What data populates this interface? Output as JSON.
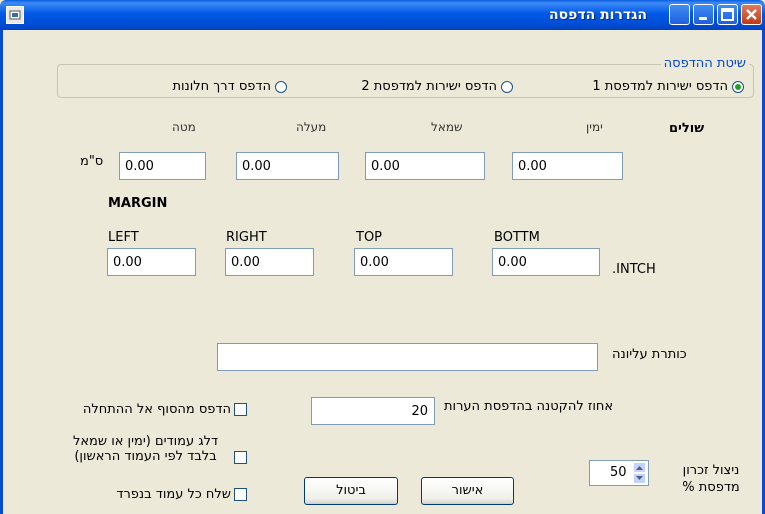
{
  "window": {
    "title": "הגדרות הדפסה",
    "icons": [
      "app-icon",
      "help-icon",
      "minimize-icon",
      "maximize-icon",
      "close-icon"
    ]
  },
  "print_method": {
    "title": "שיטת ההדפסה",
    "options": [
      {
        "label": "הדפס ישירות למדפסת 1",
        "selected": true
      },
      {
        "label": "הדפס ישירות למדפסת 2",
        "selected": false
      },
      {
        "label": "הדפס דרך חלונות",
        "selected": false
      }
    ]
  },
  "margins_cm": {
    "section_label": "שולים",
    "unit_label": "ס\"מ",
    "headers": {
      "right": "ימין",
      "left": "שמאל",
      "top": "מעלה",
      "bottom": "מטה"
    },
    "values": {
      "right": "0.00",
      "left": "0.00",
      "top": "0.00",
      "bottom": "0.00"
    }
  },
  "margins_inch": {
    "section_label": "MARGIN",
    "unit_label": ".INTCH",
    "headers": {
      "left": "LEFT",
      "right": "RIGHT",
      "top": "TOP",
      "bottom": "BOTTM"
    },
    "values": {
      "left": "0.00",
      "right": "0.00",
      "top": "0.00",
      "bottom": "0.00"
    }
  },
  "header_text": {
    "label": "כותרת עליונה",
    "value": ""
  },
  "comment_shrink": {
    "label": "אחוז להקטנה בהדפסת הערות",
    "value": "20"
  },
  "checkboxes": [
    {
      "label": "הדפס מהסוף אל ההתחלה",
      "checked": false
    },
    {
      "label": "דלג עמודים (ימין או שמאל בלבד לפי העמוד הראשון)",
      "checked": false
    },
    {
      "label": "שלח כל עמוד בנפרד",
      "checked": false
    }
  ],
  "memory_usage": {
    "label": "ניצול זכרון מדפסת %",
    "value": "50"
  },
  "buttons": {
    "ok": "אישור",
    "cancel": "ביטול"
  }
}
